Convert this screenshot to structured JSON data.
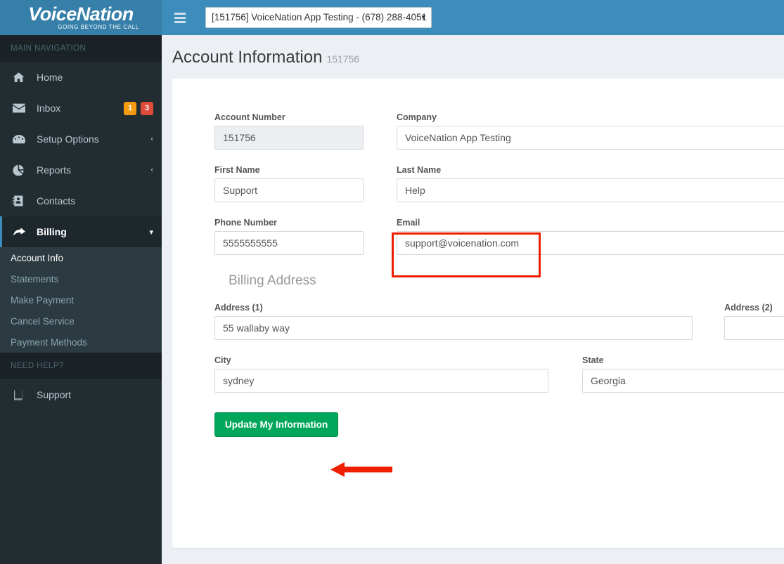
{
  "brand": {
    "name": "VoiceNation",
    "tagline": "GOING BEYOND THE CALL"
  },
  "header": {
    "menu_icon": "hamburger-icon",
    "account_selector": {
      "selected": "[151756] VoiceNation App Testing - (678) 288-4051",
      "caret": "⌄"
    }
  },
  "sidebar": {
    "main_header": "MAIN NAVIGATION",
    "items": [
      {
        "label": "Home",
        "icon": "home-icon",
        "chevron": "",
        "active": false
      },
      {
        "label": "Inbox",
        "icon": "envelope-icon",
        "chevron": "",
        "active": false,
        "badges": [
          {
            "text": "1",
            "color": "#f39c12"
          },
          {
            "text": "3",
            "color": "#dd4b39"
          }
        ]
      },
      {
        "label": "Setup Options",
        "icon": "dashboard-icon",
        "chevron": "‹",
        "active": false
      },
      {
        "label": "Reports",
        "icon": "pie-chart-icon",
        "chevron": "‹",
        "active": false
      },
      {
        "label": "Contacts",
        "icon": "address-book-icon",
        "chevron": "",
        "active": false
      },
      {
        "label": "Billing",
        "icon": "share-arrow-icon",
        "chevron": "∨",
        "active": true
      }
    ],
    "submenu": [
      {
        "label": "Account Info",
        "current": true
      },
      {
        "label": "Statements",
        "current": false
      },
      {
        "label": "Make Payment",
        "current": false
      },
      {
        "label": "Cancel Service",
        "current": false
      },
      {
        "label": "Payment Methods",
        "current": false
      }
    ],
    "help_header": "NEED HELP?",
    "help_items": [
      {
        "label": "Support",
        "icon": "book-icon"
      }
    ]
  },
  "page": {
    "title": "Account Information",
    "subtitle": "151756"
  },
  "form": {
    "fields": {
      "account_number": {
        "label": "Account Number",
        "value": "151756",
        "disabled": true
      },
      "company": {
        "label": "Company",
        "value": "VoiceNation App Testing"
      },
      "first_name": {
        "label": "First Name",
        "value": "Support"
      },
      "last_name": {
        "label": "Last Name",
        "value": "Help"
      },
      "phone_number": {
        "label": "Phone Number",
        "value": "5555555555"
      },
      "email": {
        "label": "Email",
        "value": "support@voicenation.com",
        "highlighted": true
      }
    },
    "billing_address": {
      "section_title": "Billing Address",
      "address1": {
        "label": "Address (1)",
        "value": "55 wallaby way"
      },
      "address2": {
        "label": "Address (2)",
        "value": ""
      },
      "city": {
        "label": "City",
        "value": "sydney"
      },
      "state": {
        "label": "State",
        "value": "Georgia"
      }
    },
    "submit_button": "Update My Information"
  },
  "annotations": {
    "highlight_color": "#f01e00",
    "email_box": true,
    "arrow_to_submit": true
  },
  "colors": {
    "header_blue": "#3c8dbc",
    "logo_blue": "#367fa9",
    "sidebar_dark": "#222d32",
    "sidebar_submenu": "#2c3b41",
    "content_bg": "#ecf0f5",
    "success_green": "#00a65a",
    "badge_orange": "#f39c12",
    "badge_red": "#dd4b39"
  }
}
